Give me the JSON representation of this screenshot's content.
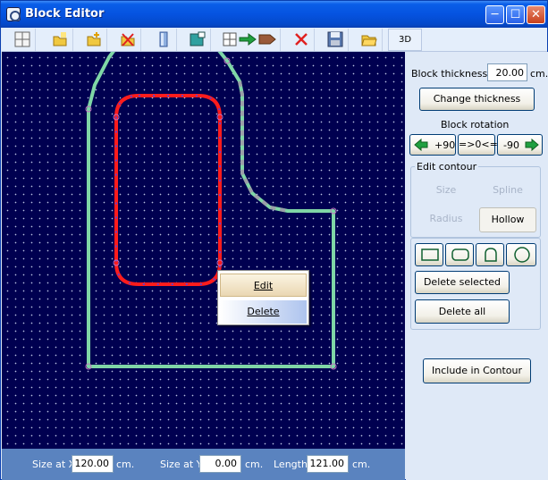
{
  "window": {
    "title": "Block Editor"
  },
  "toolbar": {
    "view3d_label": "3D",
    "tools": [
      "grid-icon",
      "new-folder-icon",
      "add-folder-icon",
      "delete-folder-icon",
      "column-icon",
      "image-icon",
      "export-arrow-icon",
      "delete-icon",
      "save-icon",
      "open-folder-icon"
    ]
  },
  "status": {
    "size_x_label": "Size at X",
    "size_x_value": "120.00",
    "size_x_unit": "cm.",
    "size_y_label": "Size at Y",
    "size_y_value": "0.00",
    "size_y_unit": "cm.",
    "length_label": "Length",
    "length_value": "121.00",
    "length_unit": "cm."
  },
  "side": {
    "thickness_label": "Block thickness",
    "thickness_value": "20.00",
    "thickness_unit": "cm.",
    "change_thickness": "Change thickness",
    "rotation_label": "Block rotation",
    "rot_plus": "+90",
    "rot_zero": "=>0<=",
    "rot_minus": "-90",
    "edit_contour_label": "Edit contour",
    "size_btn": "Size",
    "spline_btn": "Spline",
    "radius_btn": "Radius",
    "hollow_btn": "Hollow",
    "delete_selected": "Delete selected",
    "delete_all": "Delete all",
    "include_contour": "Include in Contour"
  },
  "context_menu": {
    "edit": "Edit",
    "delete": "Delete"
  },
  "colors": {
    "outer_contour": "#7fd6a6",
    "inner_contour": "#ff1c1c",
    "canvas_bg": "#000050"
  }
}
